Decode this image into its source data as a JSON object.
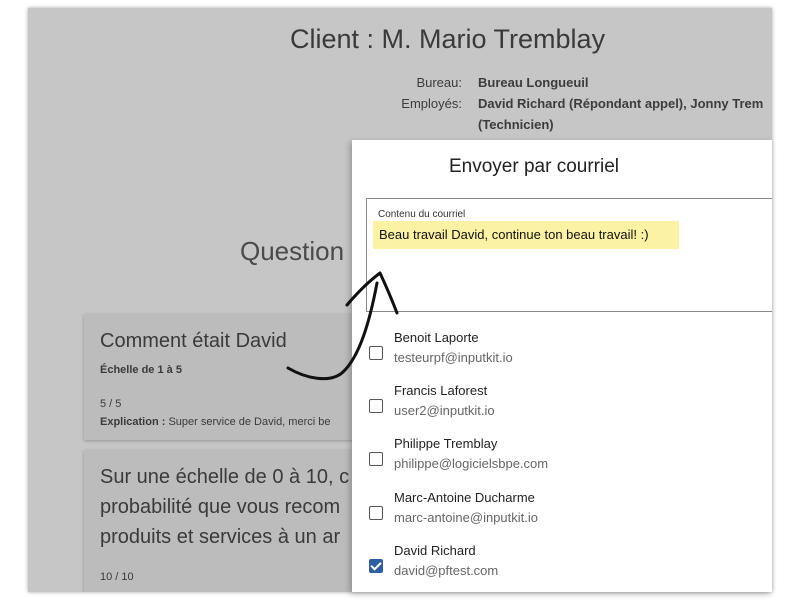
{
  "page": {
    "client_title": "Client : M. Mario Tremblay",
    "office_label": "Bureau:",
    "office_value": "Bureau Longueuil",
    "employees_label": "Employés:",
    "employees_value_line1": "David Richard (Répondant appel), Jonny Trem",
    "employees_value_line2": "(Technicien)",
    "section_title": "Question"
  },
  "cards": [
    {
      "title": "Comment était David",
      "scale": "Échelle de 1 à 5",
      "score": "5 / 5",
      "explanation_label": "Explication :",
      "explanation_text": " Super service de David, merci be"
    },
    {
      "lines": [
        "Sur une échelle de 0 à 10, c",
        "probabilité que vous recom",
        "produits et services à un ar"
      ],
      "score": "10 / 10"
    }
  ],
  "modal": {
    "title": "Envoyer par courriel",
    "email_label": "Contenu du courriel",
    "email_content": "Beau travail David, continue ton beau travail! :)",
    "recipients": [
      {
        "name": "Benoit Laporte",
        "email": "testeurpf@inputkit.io",
        "checked": false
      },
      {
        "name": "Francis Laforest",
        "email": "user2@inputkit.io",
        "checked": false
      },
      {
        "name": "Philippe Tremblay",
        "email": "philippe@logicielsbpe.com",
        "checked": false
      },
      {
        "name": "Marc-Antoine Ducharme",
        "email": "marc-antoine@inputkit.io",
        "checked": false
      },
      {
        "name": "David Richard",
        "email": "david@pftest.com",
        "checked": true
      }
    ]
  },
  "icons": {
    "annotation": "hand-drawn-arrow-icon",
    "checkbox_checked": "checkmark-icon"
  },
  "colors": {
    "overlay": "#c6c6c6",
    "highlight": "#fbf2a4",
    "checkbox_checked": "#2f5fa3",
    "arrow": "#111111"
  }
}
